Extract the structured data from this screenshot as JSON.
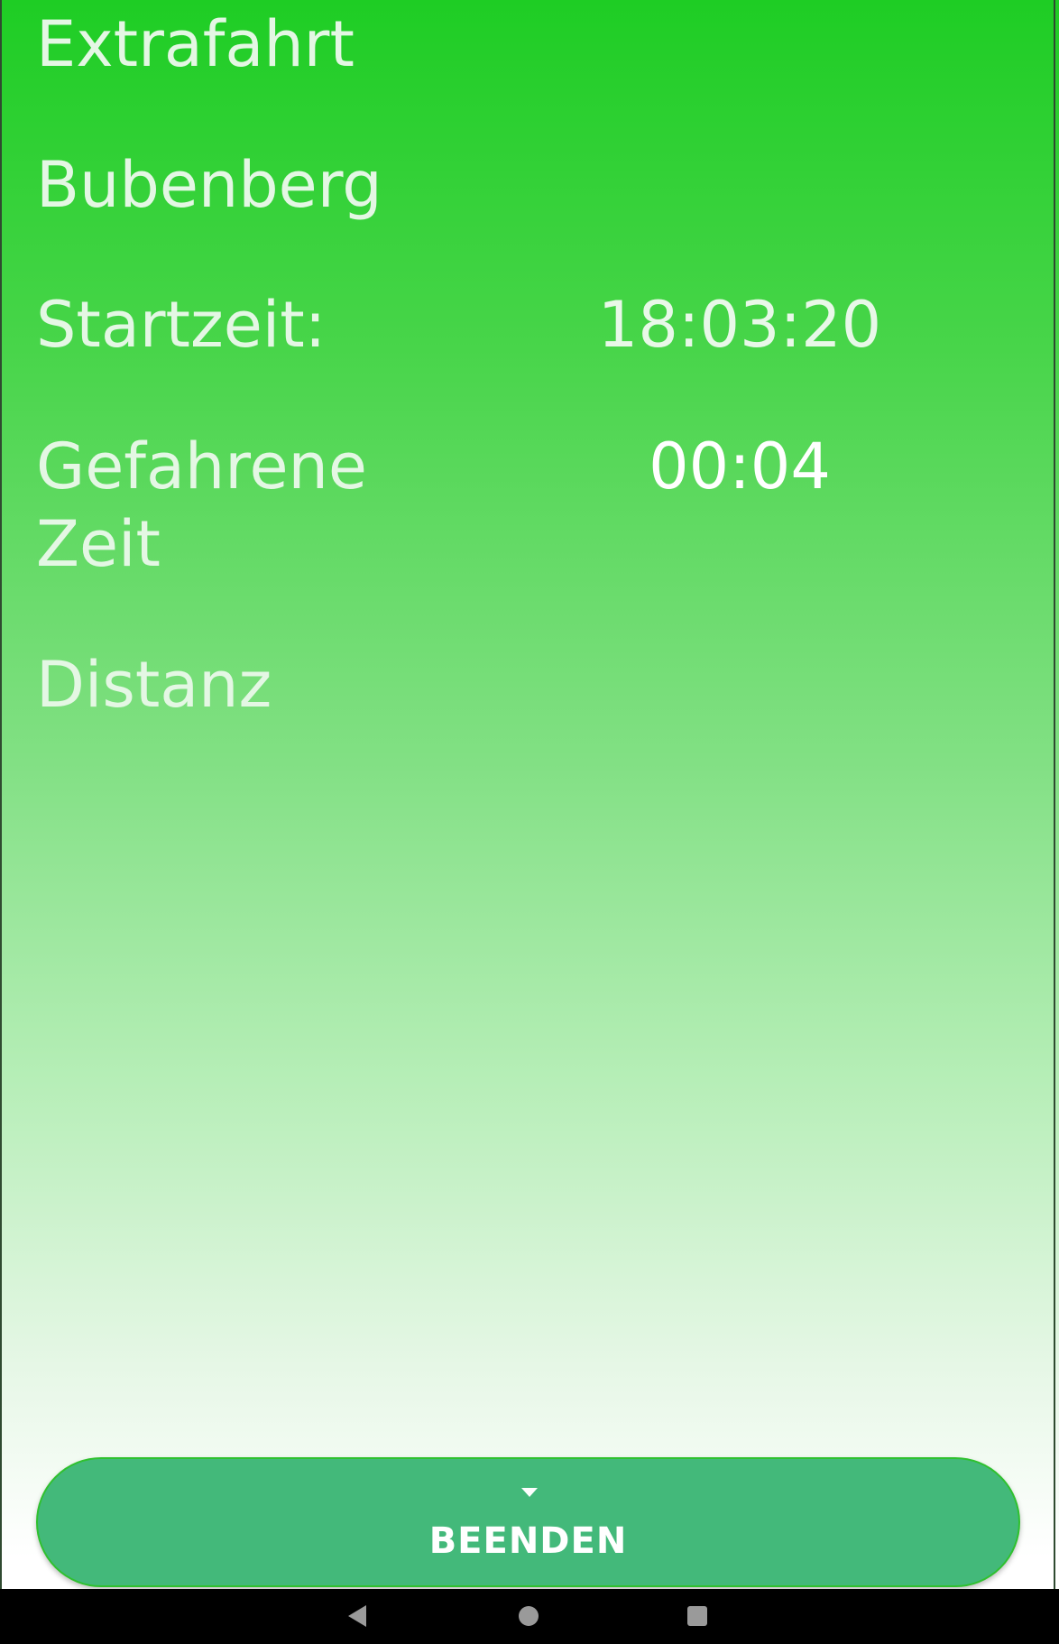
{
  "trip": {
    "type": "Extrafahrt",
    "location": "Bubenberg",
    "start_label": "Startzeit:",
    "start_value": "18:03:20",
    "elapsed_label_line1": "Gefahrene",
    "elapsed_label_line2": "Zeit",
    "elapsed_value": "00:04",
    "distance_label": "Distanz"
  },
  "actions": {
    "finish_label": "BEENDEN",
    "finish_icon": "chevron-down-icon"
  },
  "system_nav": {
    "back_icon": "back-triangle-icon",
    "home_icon": "home-circle-icon",
    "recents_icon": "recents-square-icon"
  },
  "colors": {
    "gradient_top": "#1ecd24",
    "gradient_bottom": "#ffffff",
    "button": "#43b97a"
  }
}
